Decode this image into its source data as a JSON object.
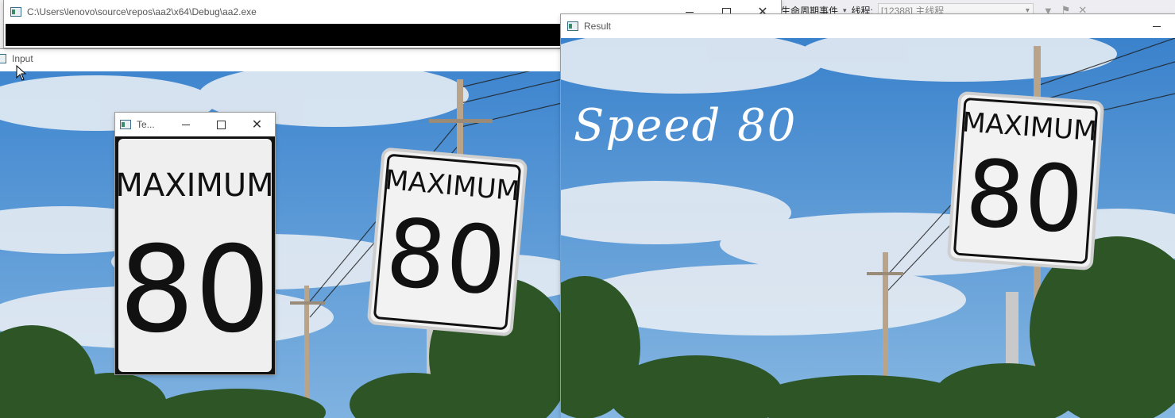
{
  "debug_toolbar": {
    "event_label": "生命周期事件",
    "thread_label": "线程:",
    "thread_value": "[12388] 主线程"
  },
  "console_window": {
    "title": "C:\\Users\\lenovo\\source\\repos\\aa2\\x64\\Debug\\aa2.exe"
  },
  "input_window": {
    "title": "Input"
  },
  "template_window": {
    "title": "Te..."
  },
  "result_window": {
    "title": "Result",
    "overlay_text": "Speed 80"
  },
  "sign": {
    "line1": "MAXIMUM",
    "line2": "80"
  },
  "icons": [
    "app-icon",
    "minimize-icon",
    "maximize-icon",
    "close-icon",
    "filter-icon",
    "mouse-cursor-icon"
  ],
  "colors": {
    "sky": "#4a90d0",
    "cloud": "#e8eef5",
    "tree": "#2f5a2a",
    "console_bg": "#000000",
    "sign_bg": "#f2f2f2"
  }
}
